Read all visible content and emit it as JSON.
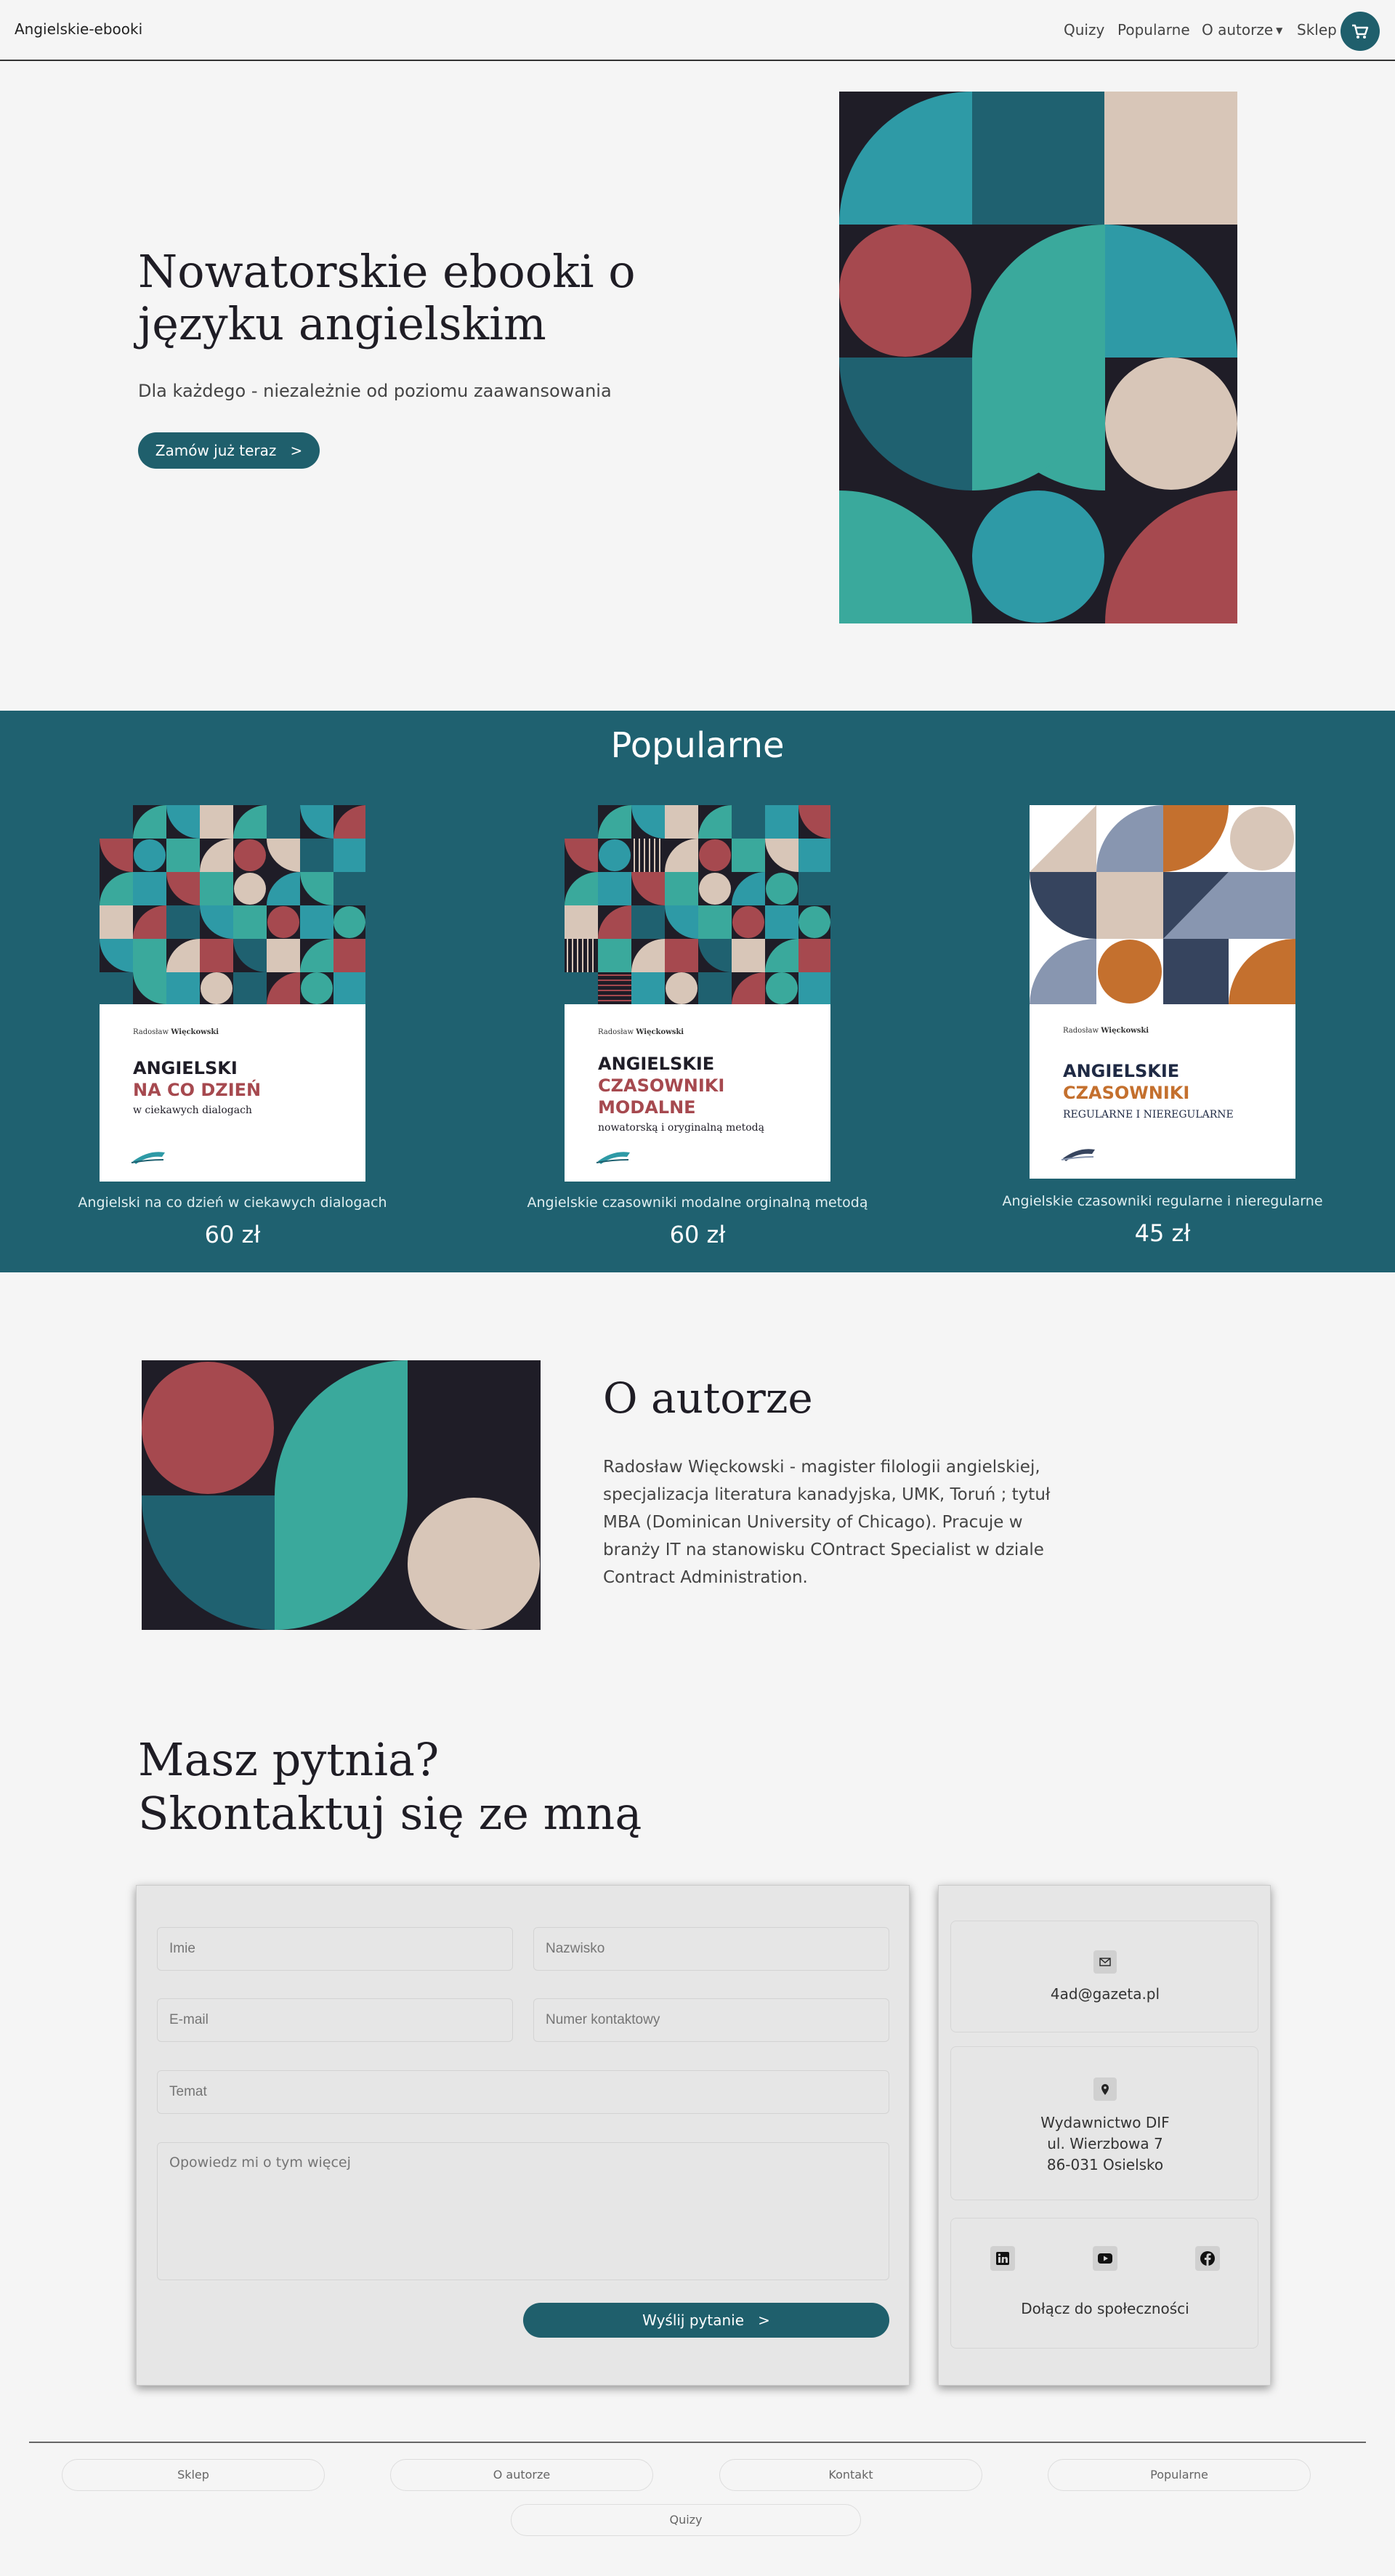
{
  "nav": {
    "brand": "Angielskie-ebooki",
    "links": [
      "Quizy",
      "Popularne",
      "O autorze",
      "Sklep"
    ],
    "cart_icon": "cart-icon"
  },
  "hero": {
    "title": "Nowatorskie ebooki o języku angielskim",
    "subtitle": "Dla każdego - niezależnie od poziomu zaawansowania",
    "button": "Zamów już teraz   >"
  },
  "popular": {
    "title": "Popularne",
    "products": [
      {
        "name": "Angielski na co dzień w ciekawych dialogach",
        "price": "60 zł",
        "cover_author_first": "Radosław",
        "cover_author_last": "Więckowski",
        "cover_l1": "ANGIELSKI",
        "cover_l2": "NA CO DZIEŃ",
        "cover_l3": "",
        "cover_sub": "w ciekawych dialogach"
      },
      {
        "name": "Angielskie czasowniki modalne orginalną metodą",
        "price": "60 zł",
        "cover_author_first": "Radosław",
        "cover_author_last": "Więckowski",
        "cover_l1": "ANGIELSKIE",
        "cover_l2": "CZASOWNIKI",
        "cover_l3": "MODALNE",
        "cover_sub": "nowatorską i oryginalną metodą"
      },
      {
        "name": "Angielskie czasowniki regularne i nieregularne",
        "price": "45 zł",
        "cover_author_first": "Radosław",
        "cover_author_last": "Więckowski",
        "cover_l1": "ANGIELSKIE",
        "cover_l2": "CZASOWNIKI",
        "cover_l3": "",
        "cover_sub": "REGULARNE I NIEREGULARNE"
      }
    ]
  },
  "about": {
    "title": "O autorze",
    "text": "Radosław Więckowski - magister filologii angielskiej, specjalizacja literatura kanadyjska, UMK, Toruń ; tytuł MBA (Dominican University of Chicago). Pracuje w branży IT na stanowisku COntract Specialist w dziale Contract Administration."
  },
  "contact": {
    "title_line1": "Masz pytnia?",
    "title_line2": "Skontaktuj się ze mną",
    "form": {
      "first_name_placeholder": "Imie",
      "last_name_placeholder": "Nazwisko",
      "email_placeholder": "E-mail",
      "phone_placeholder": "Numer kontaktowy",
      "subject_placeholder": "Temat",
      "message_placeholder": "Opowiedz mi o tym więcej",
      "submit": "Wyślij pytanie   >"
    },
    "info": {
      "email": "4ad@gazeta.pl",
      "address_line1": "Wydawnictwo DIF",
      "address_line2": "ul. Wierzbowa 7",
      "address_line3": "86-031 Osielsko",
      "social_label": "Dołącz do społeczności",
      "icons": [
        "envelope-icon",
        "map-pin-icon",
        "linkedin-icon",
        "youtube-icon",
        "facebook-icon"
      ]
    }
  },
  "footer": {
    "links": [
      "Sklep",
      "O autorze",
      "Kontakt",
      "Popularne",
      "Quizy"
    ]
  },
  "colors": {
    "teal_dark": "#1f6170",
    "teal": "#2e9aa6",
    "mint": "#3aa99c",
    "red": "#a6494f",
    "beige": "#d8c6b8",
    "ink": "#1f1d27",
    "orange": "#c4702e",
    "slate": "#8896b0",
    "navy": "#36445e"
  }
}
